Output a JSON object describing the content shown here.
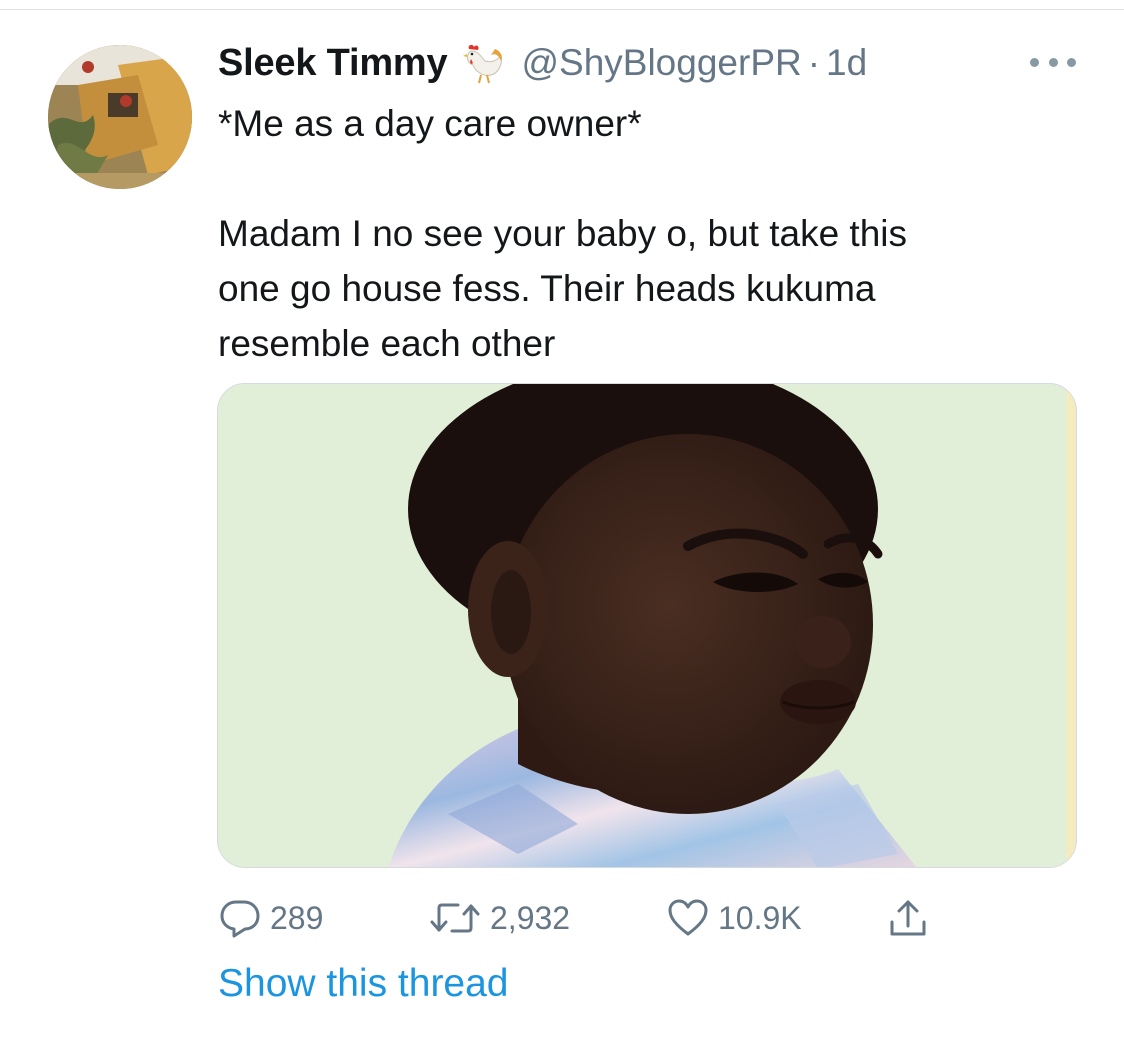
{
  "tweet": {
    "display_name": "Sleek Timmy",
    "name_emoji": "rooster-emoji",
    "handle": "@ShyBloggerPR",
    "separator": "·",
    "time": "1d",
    "text_lines": [
      "*Me as a day care owner*",
      "",
      "Madam I no see your baby o, but take this",
      "one go house fess. Their heads kukuma",
      "resemble each other"
    ],
    "actions": {
      "replies": "289",
      "retweets": "2,932",
      "likes": "10.9K"
    },
    "show_thread": "Show this thread"
  },
  "icons": {
    "reply": "reply-icon",
    "retweet": "retweet-icon",
    "like": "heart-icon",
    "share": "share-icon",
    "more": "more-icon"
  },
  "colors": {
    "text_primary": "#14171a",
    "text_secondary": "#657786",
    "link_blue": "#1b95e0",
    "media_background": "#e2efd8"
  }
}
